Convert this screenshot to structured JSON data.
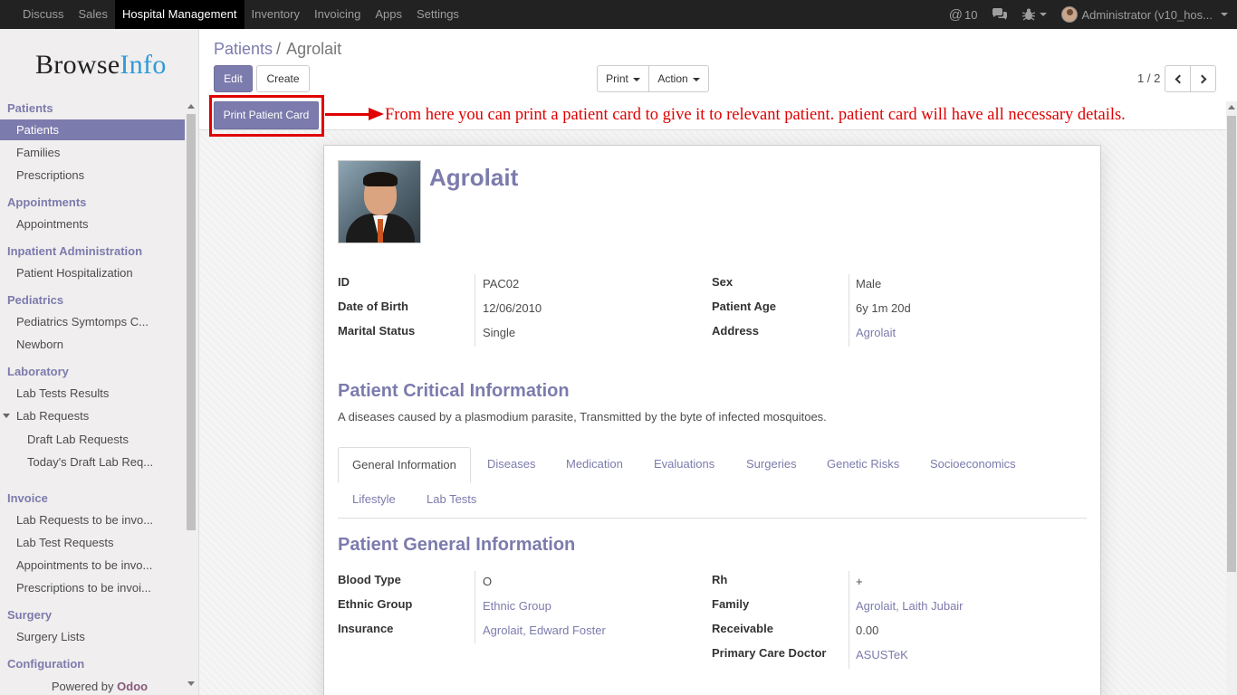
{
  "topbar": {
    "menu": [
      "Discuss",
      "Sales",
      "Hospital Management",
      "Inventory",
      "Invoicing",
      "Apps",
      "Settings"
    ],
    "active_menu": "Hospital Management",
    "mentions_count": "10",
    "user_label": "Administrator (v10_hos..."
  },
  "sidebar": {
    "logo_left": "Browse",
    "logo_right": "Info",
    "sections": [
      {
        "title": "Patients",
        "items": [
          "Patients",
          "Families",
          "Prescriptions"
        ]
      },
      {
        "title": "Appointments",
        "items": [
          "Appointments"
        ]
      },
      {
        "title": "Inpatient Administration",
        "items": [
          "Patient Hospitalization"
        ]
      },
      {
        "title": "Pediatrics",
        "items": [
          "Pediatrics Symtomps C...",
          "Newborn"
        ]
      },
      {
        "title": "Laboratory",
        "items": [
          "Lab Tests Results",
          "Lab Requests",
          "Draft Lab Requests",
          "Today's Draft Lab Req..."
        ]
      },
      {
        "title": "Invoice",
        "items": [
          "Lab Requests to be invo...",
          "Lab Test Requests",
          "Appointments to be invo...",
          "Prescriptions to be invoi..."
        ]
      },
      {
        "title": "Surgery",
        "items": [
          "Surgery Lists"
        ]
      },
      {
        "title": "Configuration",
        "items": []
      }
    ],
    "powered_by": "Powered by",
    "powered_brand": "Odoo"
  },
  "control": {
    "breadcrumb_parent": "Patients",
    "breadcrumb_sep": "/",
    "breadcrumb_current": "Agrolait",
    "edit_label": "Edit",
    "create_label": "Create",
    "print_label": "Print",
    "action_label": "Action",
    "pager": "1 / 2"
  },
  "statusbar": {
    "print_card_label": "Print Patient Card"
  },
  "annotation": {
    "text": "From here you can print a patient card to give it to relevant patient. patient card will have all necessary details.",
    "color": "#e00000"
  },
  "record": {
    "name": "Agrolait",
    "fields_left": [
      {
        "label": "ID",
        "value": "PAC02"
      },
      {
        "label": "Date of Birth",
        "value": "12/06/2010"
      },
      {
        "label": "Marital Status",
        "value": "Single"
      }
    ],
    "fields_right": [
      {
        "label": "Sex",
        "value": "Male"
      },
      {
        "label": "Patient Age",
        "value": "6y 1m 20d"
      },
      {
        "label": "Address",
        "value": "Agrolait"
      }
    ],
    "critical_title": "Patient Critical Information",
    "critical_text": "A diseases caused by a plasmodium parasite, Transmitted by the byte of infected mosquitoes.",
    "tabs": [
      "General Information",
      "Diseases",
      "Medication",
      "Evaluations",
      "Surgeries",
      "Genetic Risks",
      "Socioeconomics",
      "Lifestyle",
      "Lab Tests"
    ],
    "active_tab": "General Information",
    "general_title": "Patient General Information",
    "general_left": [
      {
        "label": "Blood Type",
        "value": "O"
      },
      {
        "label": "Ethnic Group",
        "value": "Ethnic Group"
      },
      {
        "label": "Insurance",
        "value": "Agrolait, Edward Foster"
      }
    ],
    "general_right": [
      {
        "label": "Rh",
        "value": "+"
      },
      {
        "label": "Family",
        "value": "Agrolait, Laith Jubair"
      },
      {
        "label": "Receivable",
        "value": "0.00"
      },
      {
        "label": "Primary Care Doctor",
        "value": "ASUSTeK"
      }
    ]
  },
  "colors": {
    "accent": "#7c7bad",
    "topbar": "#222222",
    "brand_odoo": "#875a7b"
  }
}
